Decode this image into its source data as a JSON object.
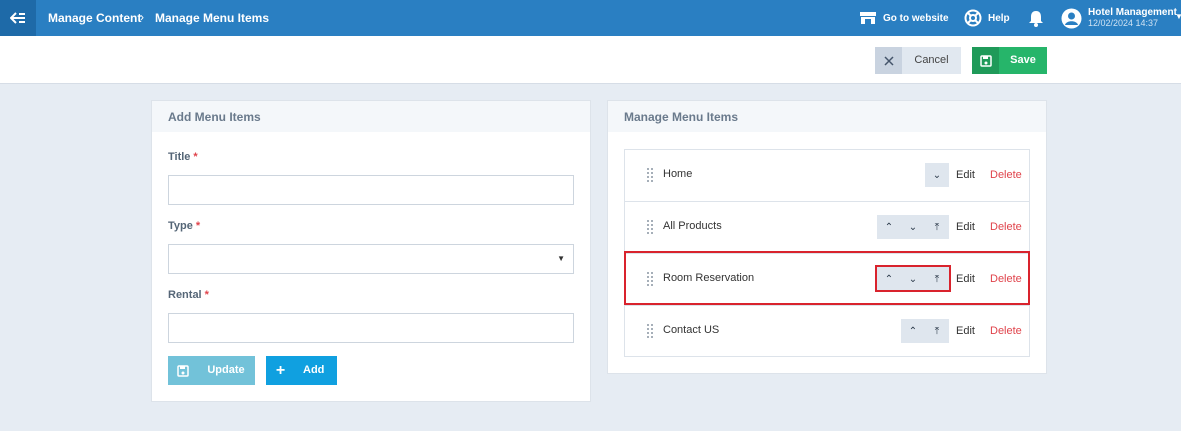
{
  "breadcrumb": {
    "first": "Manage Content",
    "second": "Manage Menu Items"
  },
  "header": {
    "go_to_website": "Go to website",
    "help": "Help",
    "user_name": "Hotel Management",
    "user_date": "12/02/2024 14:37"
  },
  "actions": {
    "cancel": "Cancel",
    "save": "Save"
  },
  "add_panel": {
    "title": "Add Menu Items",
    "title_label": "Title",
    "type_label": "Type",
    "rental_label": "Rental",
    "required_mark": "*",
    "update": "Update",
    "add": "Add"
  },
  "manage_panel": {
    "title": "Manage Menu Items",
    "edit": "Edit",
    "delete": "Delete",
    "items": [
      {
        "title": "Home",
        "controls": [
          "move-down"
        ]
      },
      {
        "title": "All Products",
        "controls": [
          "move-up",
          "move-down",
          "move-top"
        ]
      },
      {
        "title": "Room Reservation",
        "controls": [
          "move-up",
          "move-down",
          "move-top"
        ]
      },
      {
        "title": "Contact US",
        "controls": [
          "move-up",
          "move-top"
        ]
      }
    ]
  },
  "colors": {
    "topbar": "#2a7fc2",
    "save": "#26b56a",
    "add": "#10a0e0",
    "update": "#72c2d9",
    "delete": "#e0434b",
    "highlight": "#d9232d"
  }
}
